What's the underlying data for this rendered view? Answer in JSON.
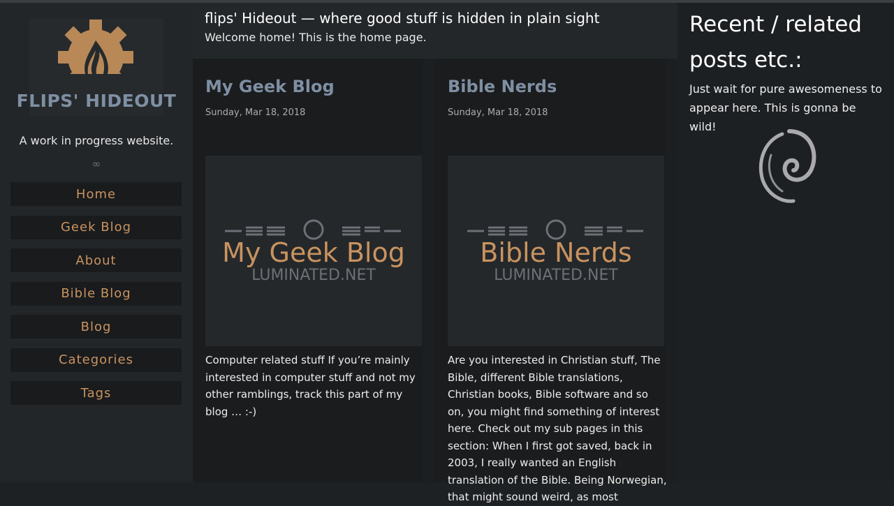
{
  "sidebar": {
    "logo_text": "FLIPS' HIDEOUT",
    "tagline": "A work in progress website.",
    "separator": "∞",
    "nav": [
      {
        "label": "Home"
      },
      {
        "label": "Geek Blog"
      },
      {
        "label": "About"
      },
      {
        "label": "Bible Blog"
      },
      {
        "label": "Blog"
      },
      {
        "label": "Categories"
      },
      {
        "label": "Tags"
      }
    ]
  },
  "header": {
    "title": "flips' Hideout — where good stuff is hidden in plain sight",
    "welcome": "Welcome home! This is the home page."
  },
  "posts": [
    {
      "title": "My Geek Blog",
      "date": "Sunday, Mar 18, 2018",
      "image_title": "My Geek Blog",
      "image_sub": "LUMINATED.NET",
      "excerpt": "Computer related stuff If you’re mainly interested in computer stuff and not my other ramblings, track this part of my blog … :-)"
    },
    {
      "title": "Bible Nerds",
      "date": "Sunday, Mar 18, 2018",
      "image_title": "Bible Nerds",
      "image_sub": "LUMINATED.NET",
      "excerpt": "Are you interested in Christian stuff, The Bible, different Bible translations, Christian books, Bible software and so on, you might find something of interest here. Check out my sub pages in this section: When I first got saved, back in 2003, I really wanted an English translation of the Bible. Being Norwegian, that might sound weird, as most"
    }
  ],
  "aside": {
    "title": "Recent / related posts etc.:",
    "text": "Just wait for pure awesomeness to appear here. This is gonna be wild!"
  },
  "colors": {
    "accent": "#c9935f",
    "heading_blue": "#7f8fa3",
    "background": "#1e2124"
  }
}
